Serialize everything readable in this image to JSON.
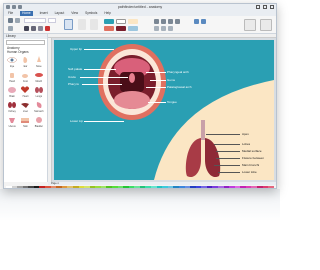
{
  "window": {
    "title": "pathfinder/untitled - anatomy"
  },
  "menu": {
    "items": [
      "File",
      "Home",
      "Insert",
      "Layout",
      "View",
      "Symbols",
      "Help"
    ],
    "active": "Home"
  },
  "library": {
    "header": "Library",
    "categories": [
      "Anatomy",
      "Human Organs"
    ],
    "items": [
      "Eye",
      "Ear",
      "Nose",
      "Hand",
      "Foot",
      "Mouth",
      "Brain",
      "Heart",
      "Lungs",
      "Kidney",
      "Liver",
      "Stomach",
      "Uterus",
      "Skin",
      "Bladder"
    ]
  },
  "diagram": {
    "mouth_labels": [
      "Upper lip",
      "Soft palate",
      "Uvula",
      "Pharynx",
      "Pharyngeal arch",
      "Gums",
      "Palatoglossal arch",
      "Tongue",
      "Lower Lip"
    ],
    "lung_labels": [
      "Apex",
      "Lobes",
      "Medial surface",
      "Fissure between",
      "Main bronchi",
      "Lower lobe"
    ]
  },
  "pagetabs": {
    "label": "Page-1"
  },
  "colors": {
    "accent": "#3a6fb0",
    "sheet": "#2a9fb3",
    "cream": "#fbe6c4",
    "lip": "#e07060",
    "throat": "#7a1e2c"
  }
}
